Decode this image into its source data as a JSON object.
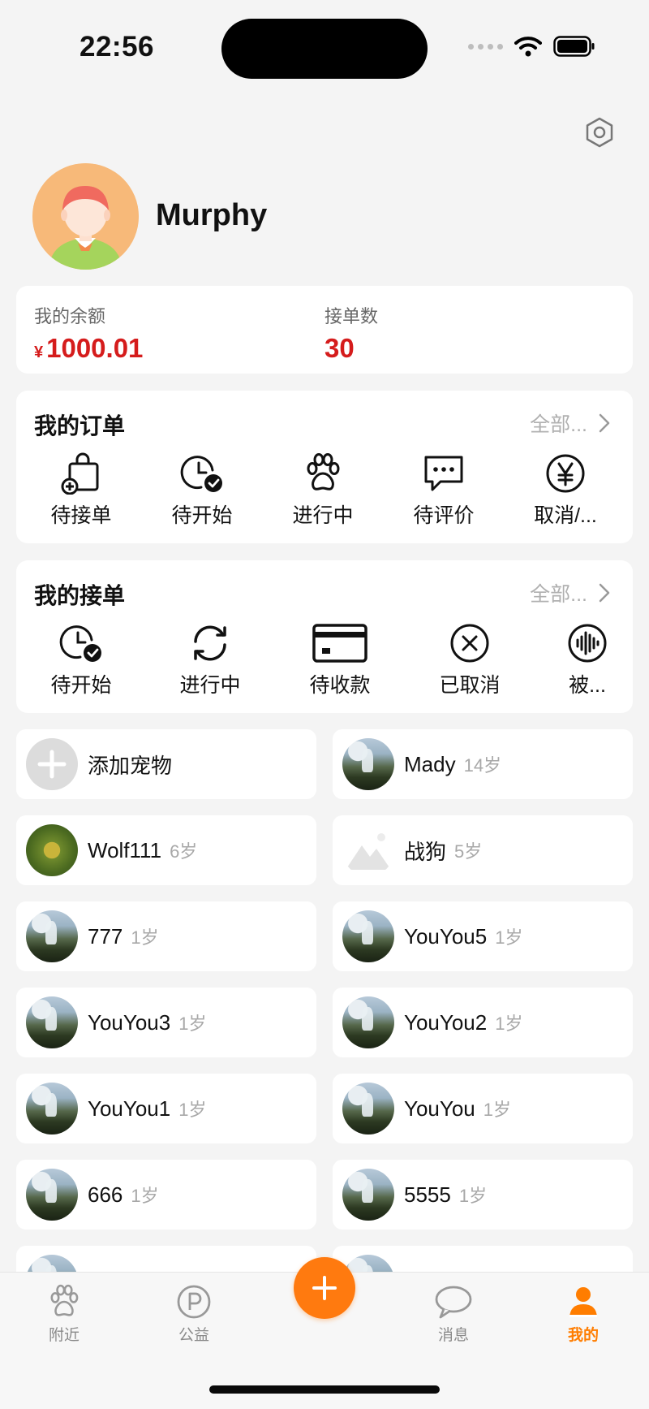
{
  "status_bar": {
    "time": "22:56"
  },
  "profile": {
    "username": "Murphy"
  },
  "stats": {
    "balance_label": "我的余额",
    "balance_currency": "¥",
    "balance_value": "1000.01",
    "orders_count_label": "接单数",
    "orders_count_value": "30"
  },
  "my_orders": {
    "title": "我的订单",
    "more_label": "全部...",
    "items": [
      {
        "label": "待接单",
        "icon": "bag-plus-icon"
      },
      {
        "label": "待开始",
        "icon": "clock-check-icon"
      },
      {
        "label": "进行中",
        "icon": "paw-icon"
      },
      {
        "label": "待评价",
        "icon": "chat-bubble-icon"
      },
      {
        "label": "取消/...",
        "icon": "yen-circle-icon"
      }
    ]
  },
  "my_accepted": {
    "title": "我的接单",
    "more_label": "全部...",
    "items": [
      {
        "label": "待开始",
        "icon": "clock-check-icon"
      },
      {
        "label": "进行中",
        "icon": "refresh-icon"
      },
      {
        "label": "待收款",
        "icon": "credit-card-icon"
      },
      {
        "label": "已取消",
        "icon": "x-circle-icon"
      },
      {
        "label": "被...",
        "icon": "soundwave-circle-icon"
      }
    ]
  },
  "pets": {
    "add_label": "添加宠物",
    "items": [
      {
        "name": "Mady",
        "age": "14岁"
      },
      {
        "name": "Wolf111",
        "age": "6岁"
      },
      {
        "name": "战狗",
        "age": "5岁"
      },
      {
        "name": "777",
        "age": "1岁"
      },
      {
        "name": "YouYou5",
        "age": "1岁"
      },
      {
        "name": "YouYou3",
        "age": "1岁"
      },
      {
        "name": "YouYou2",
        "age": "1岁"
      },
      {
        "name": "YouYou1",
        "age": "1岁"
      },
      {
        "name": "YouYou",
        "age": "1岁"
      },
      {
        "name": "666",
        "age": "1岁"
      },
      {
        "name": "5555",
        "age": "1岁"
      }
    ]
  },
  "tabbar": {
    "tabs": [
      {
        "label": "附近",
        "icon": "paw-icon"
      },
      {
        "label": "公益",
        "icon": "parking-p-icon"
      },
      {
        "label": "消息",
        "icon": "message-bubble-icon"
      },
      {
        "label": "我的",
        "icon": "person-icon",
        "active": true
      }
    ],
    "fab_icon": "plus-icon"
  },
  "colors": {
    "accent": "#ff7a0f",
    "price": "#d51c1c",
    "background": "#f4f4f4"
  }
}
